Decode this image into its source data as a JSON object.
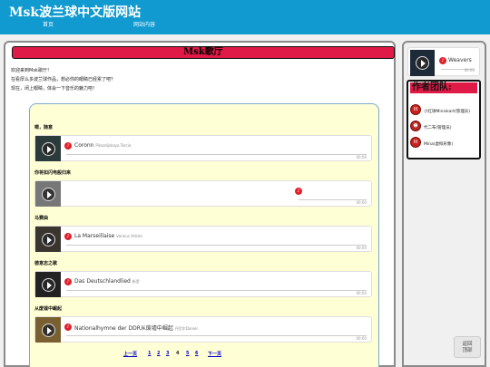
{
  "site": {
    "title": "Msk波兰球中文版网站"
  },
  "nav": {
    "home": "首页",
    "content": "网站内容"
  },
  "main": {
    "title": "Msk歌厅",
    "intro": [
      "欢迎来到Msk歌厅！",
      "在看厚么多波兰球作品，想必你的眼睛已经累了吧？",
      "现在，闭上眼睛，体会一下音乐的魅力吧！"
    ]
  },
  "songs": [
    {
      "heading": "嗯，随意",
      "name": "Coronn",
      "artist": "Pikardijskaya Tercia",
      "time": "00:00"
    },
    {
      "heading": "你将如闪电般归来",
      "name": "",
      "artist": "",
      "time": "00:00"
    },
    {
      "heading": "马赛曲",
      "name": "La Marseillaise",
      "artist": "Various Artists",
      "time": "00:00"
    },
    {
      "heading": "德意志之歌",
      "name": "Das Deutschlandlied",
      "artist": "新里",
      "time": "00:00"
    },
    {
      "heading": "从废墟中崛起",
      "name": "Nationalhymne der DDR从废墟中崛起",
      "artist": "丹尼尔Daniel",
      "time": "00:00"
    }
  ],
  "pagination": {
    "prev": "上一页",
    "pages": [
      "1",
      "2",
      "3",
      "4",
      "5",
      "6"
    ],
    "current": "4",
    "next": "下一页"
  },
  "aside_player": {
    "name": "Weavers",
    "artist": "-",
    "time": "00:00"
  },
  "team": {
    "title": "作者团队:",
    "members": [
      "小红球Miniskart(管理员)",
      "代二布(管理员)",
      "Mina(虚拟形象)"
    ]
  },
  "back_to_top": {
    "line1": "返回",
    "line2": "顶部"
  },
  "colors": {
    "header": "#109ad0",
    "accent": "#e01a46",
    "box_bg": "#ffffd6"
  }
}
